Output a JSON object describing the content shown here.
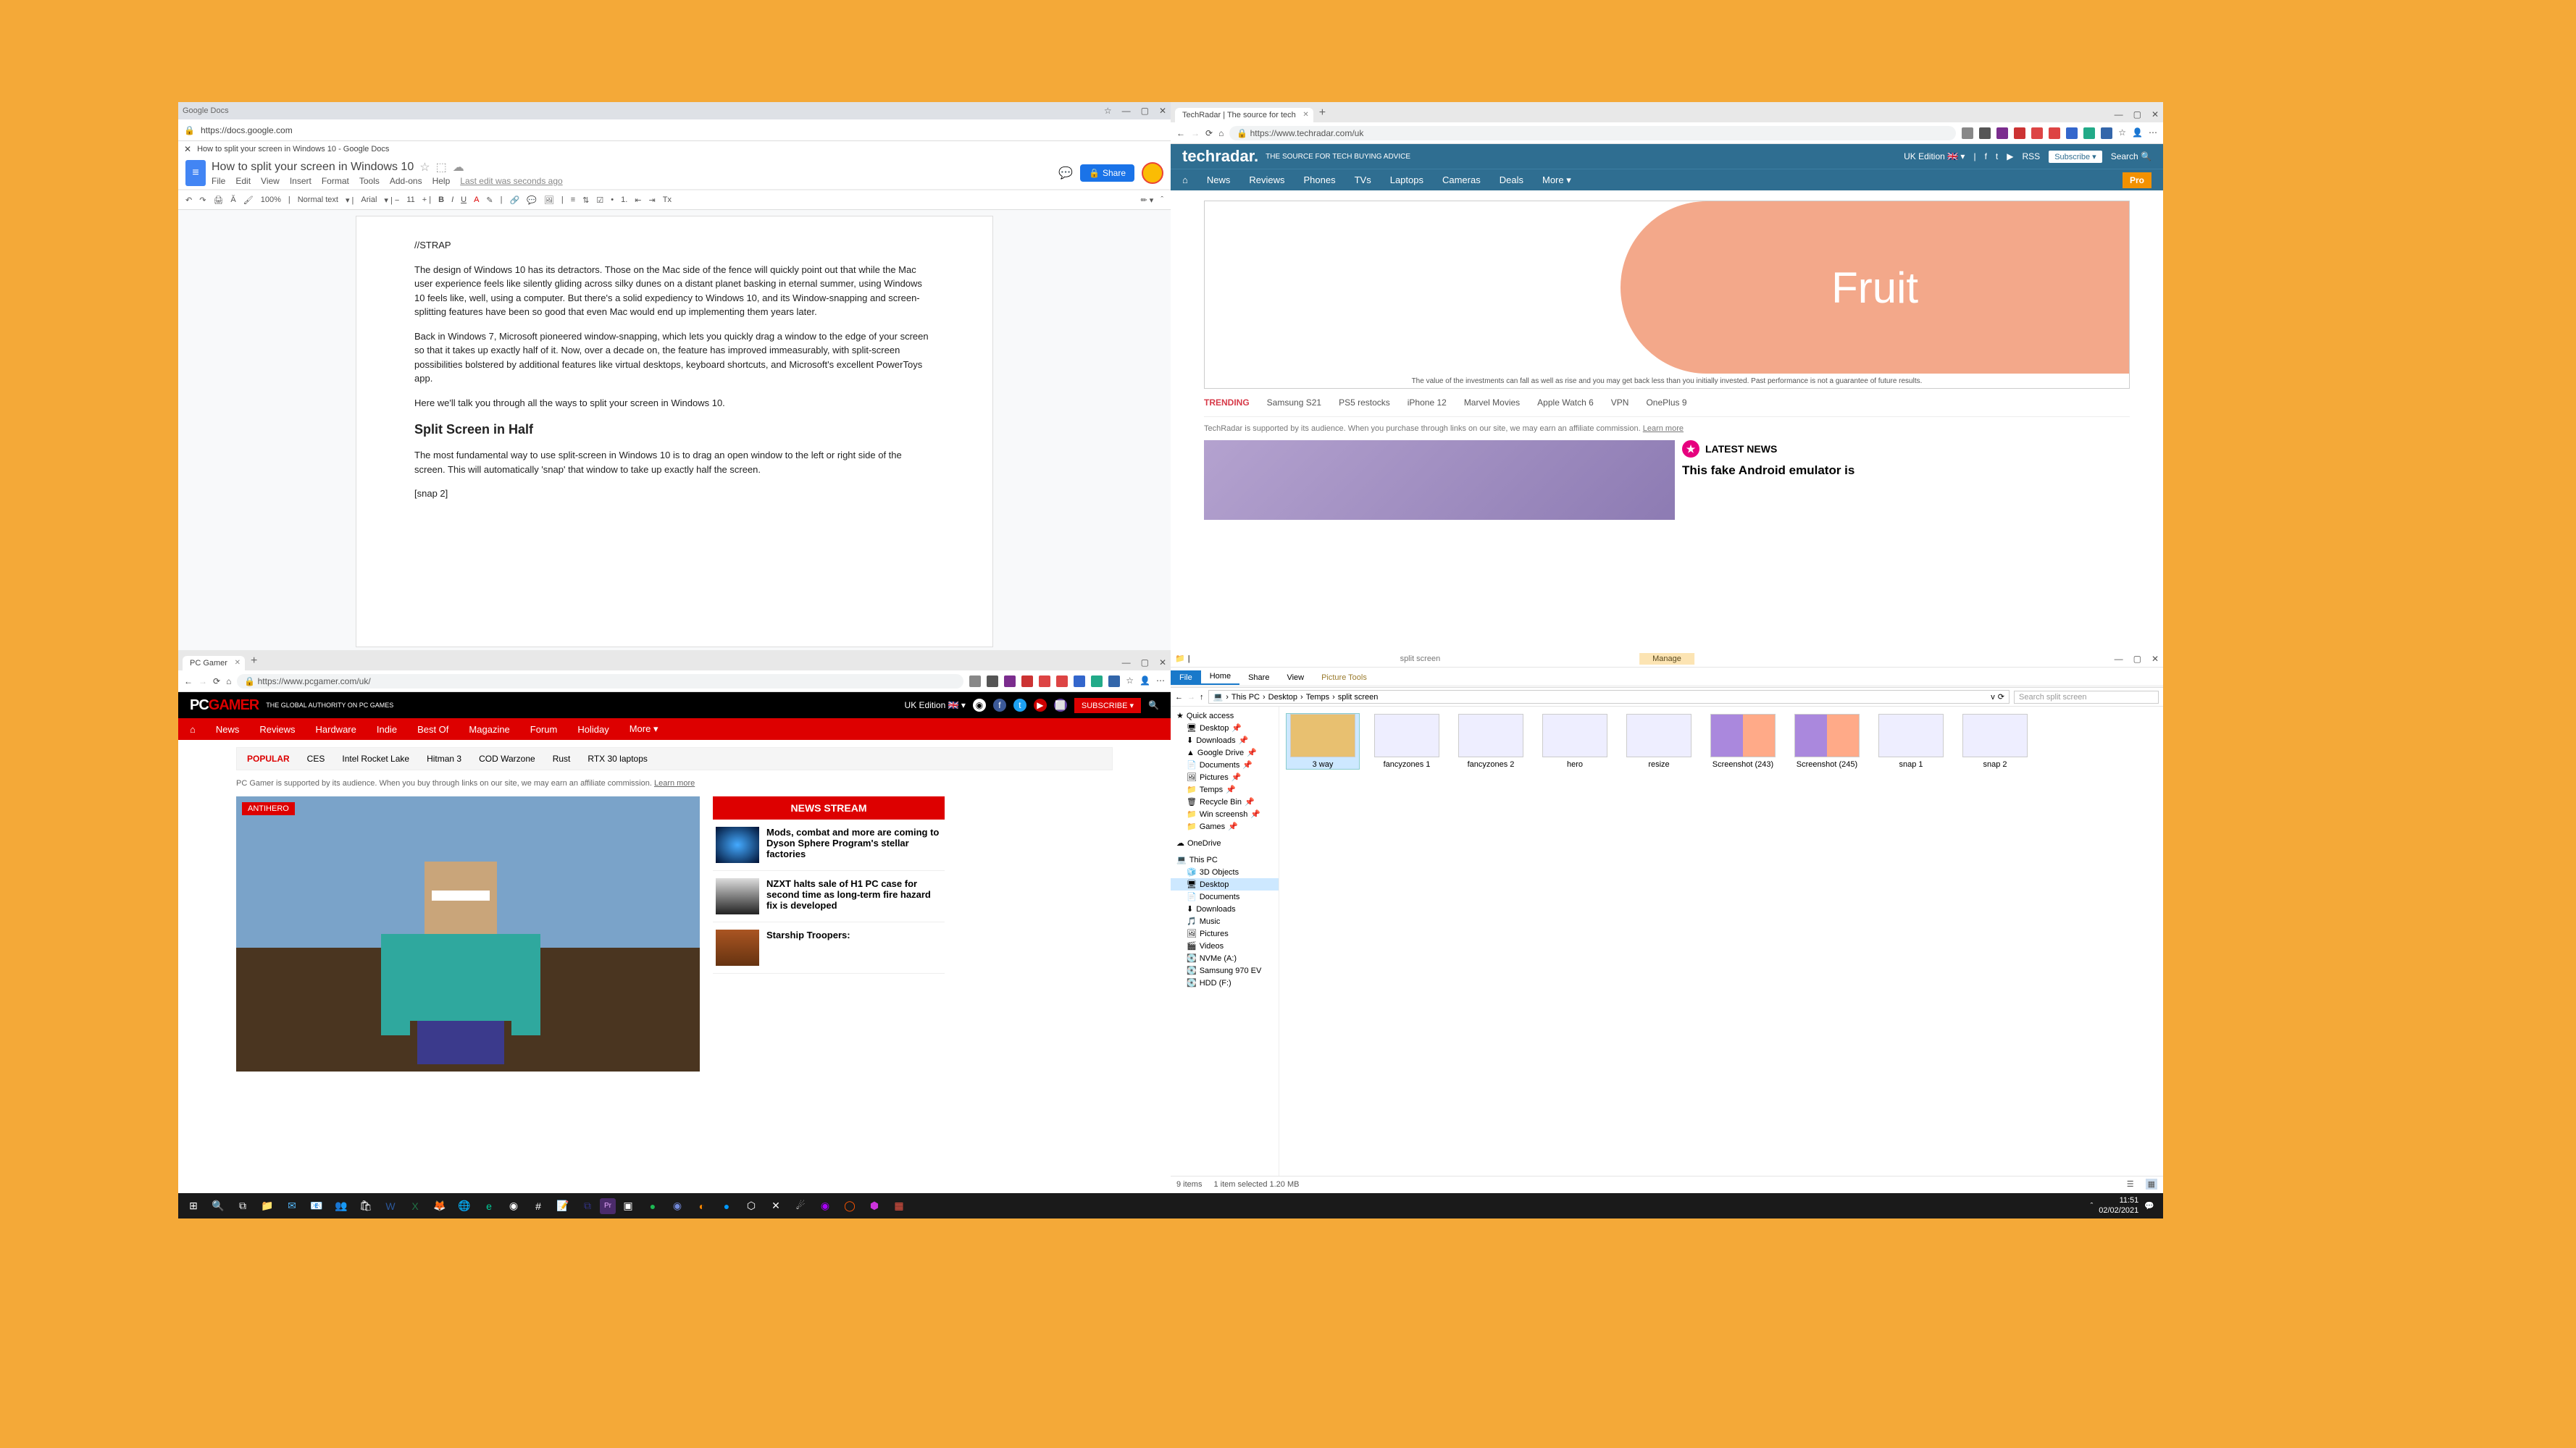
{
  "taskbar": {
    "time": "11:51",
    "date": "02/02/2021"
  },
  "q1": {
    "titlebar": "Google Docs",
    "addr_host": "https://docs.google.com",
    "tab": "How to split your screen in Windows 10 - Google Docs",
    "doc_title": "How to split your screen in Windows 10",
    "menus": [
      "File",
      "Edit",
      "View",
      "Insert",
      "Format",
      "Tools",
      "Add-ons",
      "Help"
    ],
    "last_edit": "Last edit was seconds ago",
    "share": "Share",
    "toolbar": {
      "zoom": "100%",
      "style": "Normal text",
      "font": "Arial",
      "size": "11"
    },
    "body": {
      "strap": "//STRAP",
      "p1": "The design of Windows 10 has its detractors. Those on the Mac side of the fence will quickly point out that while the Mac user experience feels like silently gliding across silky dunes on a distant planet basking in eternal summer, using Windows 10 feels like, well, using a computer. But there's a solid expediency to Windows 10, and its Window-snapping and screen-splitting features have been so good that even Mac would end up implementing them years later.",
      "p2": "Back in Windows 7, Microsoft pioneered window-snapping, which lets you quickly drag a window to the edge of your screen so that it takes up exactly half of it. Now, over a decade on, the feature has improved immeasurably, with split-screen possibilities bolstered by additional features like virtual desktops, keyboard shortcuts, and Microsoft's excellent PowerToys app.",
      "p3": "Here we'll talk you through all the ways to split your screen in Windows 10.",
      "h1": "Split Screen in Half",
      "p4": "The most fundamental way to use split-screen in Windows 10 is to drag an open window to the left or right side of the screen. This will automatically 'snap' that window to take up exactly half the screen.",
      "snap": "[snap 2]"
    }
  },
  "q2": {
    "tab": "TechRadar | The source for tech",
    "url": "https://www.techradar.com/uk",
    "logo": "techradar.",
    "tagline": "THE SOURCE FOR TECH BUYING ADVICE",
    "edition": "UK Edition",
    "rss": "RSS",
    "subscribe": "Subscribe ▾",
    "search": "Search",
    "pro": "Pro",
    "nav": [
      "News",
      "Reviews",
      "Phones",
      "TVs",
      "Laptops",
      "Cameras",
      "Deals",
      "More ▾"
    ],
    "ad_text": "Fruit",
    "ad_disc": "The value of the investments can fall as well as rise and you may get back less than you initially invested. Past performance is not a guarantee of future results.",
    "trending_label": "TRENDING",
    "trending": [
      "Samsung S21",
      "PS5 restocks",
      "iPhone 12",
      "Marvel Movies",
      "Apple Watch 6",
      "VPN",
      "OnePlus 9"
    ],
    "support": "TechRadar is supported by its audience. When you purchase through links on our site, we may earn an affiliate commission.",
    "learn": "Learn more",
    "latest": "LATEST NEWS",
    "headline": "This fake Android emulator is"
  },
  "q3": {
    "tab": "PC Gamer",
    "url": "https://www.pcgamer.com/uk/",
    "logo_pc": "PC",
    "logo_g": "GAMER",
    "tagline": "THE GLOBAL AUTHORITY ON PC GAMES",
    "edition": "UK Edition",
    "subscribe": "SUBSCRIBE ▾",
    "nav": [
      "News",
      "Reviews",
      "Hardware",
      "Indie",
      "Best Of",
      "Magazine",
      "Forum",
      "Holiday",
      "More ▾"
    ],
    "popular_label": "POPULAR",
    "popular": [
      "CES",
      "Intel Rocket Lake",
      "Hitman 3",
      "COD Warzone",
      "Rust",
      "RTX 30 laptops"
    ],
    "support": "PC Gamer is supported by its audience. When you buy through links on our site, we may earn an affiliate commission.",
    "learn": "Learn more",
    "badge": "ANTIHERO",
    "stream_hdr": "NEWS STREAM",
    "items": [
      "Mods, combat and more are coming to Dyson Sphere Program's stellar factories",
      "NZXT halts sale of H1 PC case for second time as long-term fire hazard fix is developed",
      "Starship Troopers:"
    ]
  },
  "q4": {
    "tab_manage": "Manage",
    "tab_context": "split screen",
    "ribbon": [
      "File",
      "Home",
      "Share",
      "View",
      "Picture Tools"
    ],
    "crumbs": [
      "This PC",
      "Desktop",
      "Temps",
      "split screen"
    ],
    "search_ph": "Search split screen",
    "side_quick": "Quick access",
    "side_items1": [
      "Desktop",
      "Downloads",
      "Google Drive",
      "Documents",
      "Pictures",
      "Temps",
      "Recycle Bin",
      "Win screensh",
      "Games"
    ],
    "side_onedrive": "OneDrive",
    "side_thispc": "This PC",
    "side_items2": [
      "3D Objects",
      "Desktop",
      "Documents",
      "Downloads",
      "Music",
      "Pictures",
      "Videos",
      "NVMe (A:)",
      "Samsung 970 EV",
      "HDD (F:)"
    ],
    "files": [
      "3 way",
      "fancyzones 1",
      "fancyzones 2",
      "hero",
      "resize",
      "Screenshot (243)",
      "Screenshot (245)",
      "snap 1",
      "snap 2"
    ],
    "status_count": "9 items",
    "status_sel": "1 item selected  1.20 MB"
  }
}
